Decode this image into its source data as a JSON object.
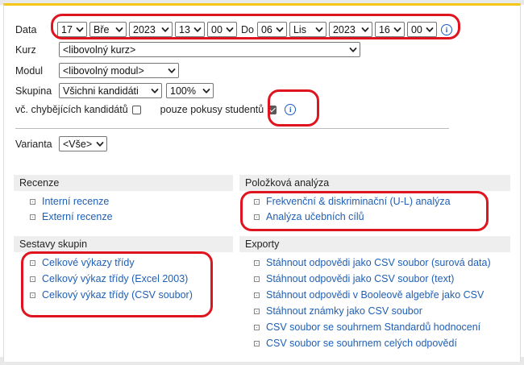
{
  "filters": {
    "date_label": "Data",
    "from": {
      "day": "17",
      "month": "Bře",
      "year": "2023",
      "hour": "13",
      "minute": "00"
    },
    "to_label": "Do",
    "to": {
      "day": "06",
      "month": "Lis",
      "year": "2023",
      "hour": "16",
      "minute": "00"
    },
    "course_label": "Kurz",
    "course_value": "<libovolný kurz>",
    "module_label": "Modul",
    "module_value": "<libovolný modul>",
    "group_label": "Skupina",
    "group_value": "Všichni kandidáti",
    "percent_value": "100%",
    "include_missing_label": "vč. chybějících kandidátů",
    "students_only_label": "pouze pokusy studentů",
    "variant_label": "Varianta",
    "variant_value": "<Vše>"
  },
  "sections": {
    "reviews": {
      "title": "Recenze",
      "items": [
        "Interní recenze",
        "Externí recenze"
      ]
    },
    "item_analysis": {
      "title": "Položková analýza",
      "items": [
        "Frekvenční & diskriminační (U-L) analýza",
        "Analýza učebních cílů"
      ]
    },
    "group_reports": {
      "title": "Sestavy skupin",
      "items": [
        "Celkové výkazy třídy",
        "Celkový výkaz třídy (Excel 2003)",
        "Celkový výkaz třídy (CSV soubor)"
      ]
    },
    "exports": {
      "title": "Exporty",
      "items": [
        "Stáhnout odpovědi jako CSV soubor (surová data)",
        "Stáhnout odpovědi jako CSV soubor (text)",
        "Stáhnout odpovědi v Booleově algebře jako CSV",
        "Stáhnout známky jako CSV soubor",
        "CSV soubor se souhrnem Standardů hodnocení",
        "CSV soubor se souhrnem celých odpovědí"
      ]
    }
  },
  "colors": {
    "link": "#1f5fb5",
    "annotation": "#e0141e",
    "accent_top": "#f5c518",
    "section_bg": "#eeeeee"
  },
  "icons": {
    "info": "info-circle-icon",
    "select": "chevron-down-icon",
    "bullet": "square-bullet-icon"
  }
}
